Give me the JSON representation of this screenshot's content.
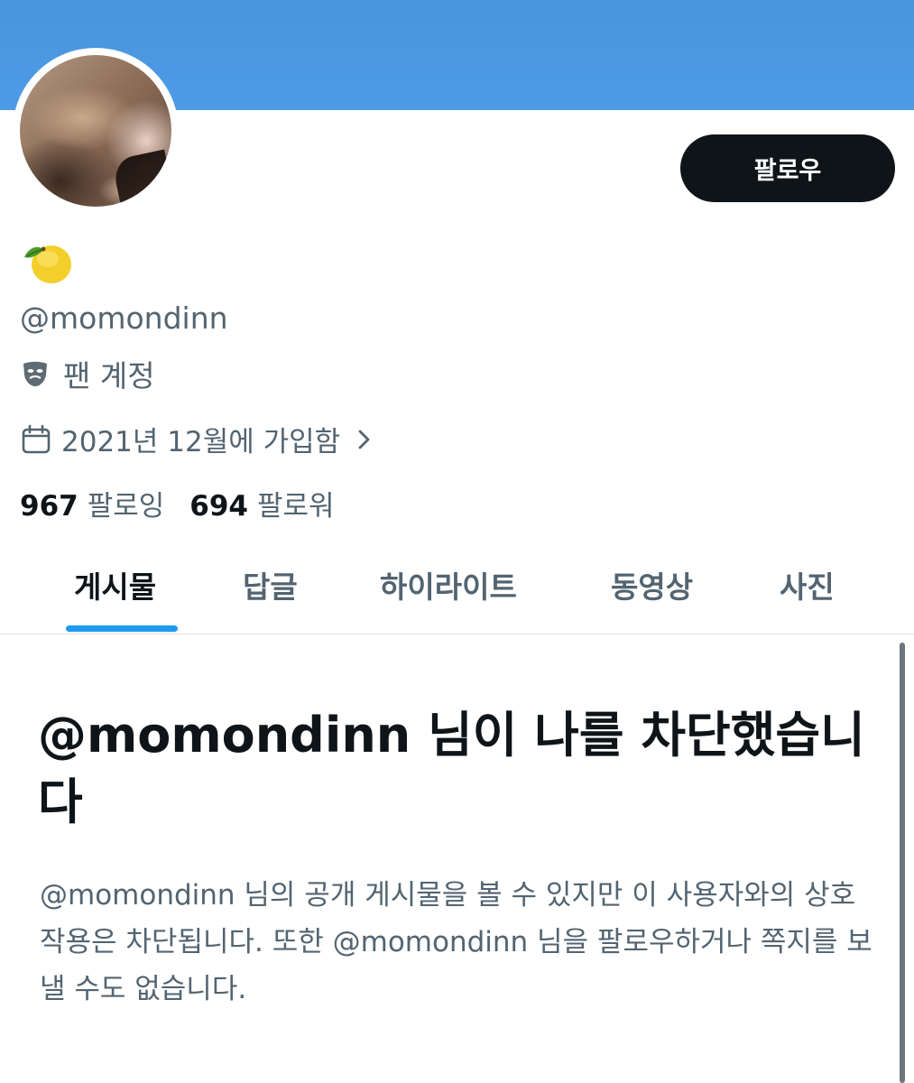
{
  "profile": {
    "handle": "@momondinn",
    "emoji_name": "lemon-emoji",
    "category_icon": "performing-arts-mask-icon",
    "category": "팬 계정",
    "joined": "2021년 12월에 가입함",
    "following_count": "967",
    "following_label": "팔로잉",
    "followers_count": "694",
    "followers_label": "팔로워"
  },
  "actions": {
    "follow_label": "팔로우"
  },
  "tabs": [
    {
      "label": "게시물",
      "active": true
    },
    {
      "label": "답글",
      "active": false
    },
    {
      "label": "하이라이트",
      "active": false
    },
    {
      "label": "동영상",
      "active": false
    },
    {
      "label": "사진",
      "active": false
    }
  ],
  "blocked": {
    "title": "@momondinn 님이 나를 차단했습니다",
    "body": "@momondinn 님의 공개 게시물을 볼 수 있지만 이 사용자와의 상호작용은 차단됩니다. 또한 @momondinn 님을 팔로우하거나 쪽지를 보낼 수도 없습니다."
  },
  "colors": {
    "banner": "#4d9be6",
    "primary_text": "#0f1419",
    "secondary_text": "#536471",
    "accent": "#1d9bf0",
    "button_bg": "#0f1419"
  }
}
